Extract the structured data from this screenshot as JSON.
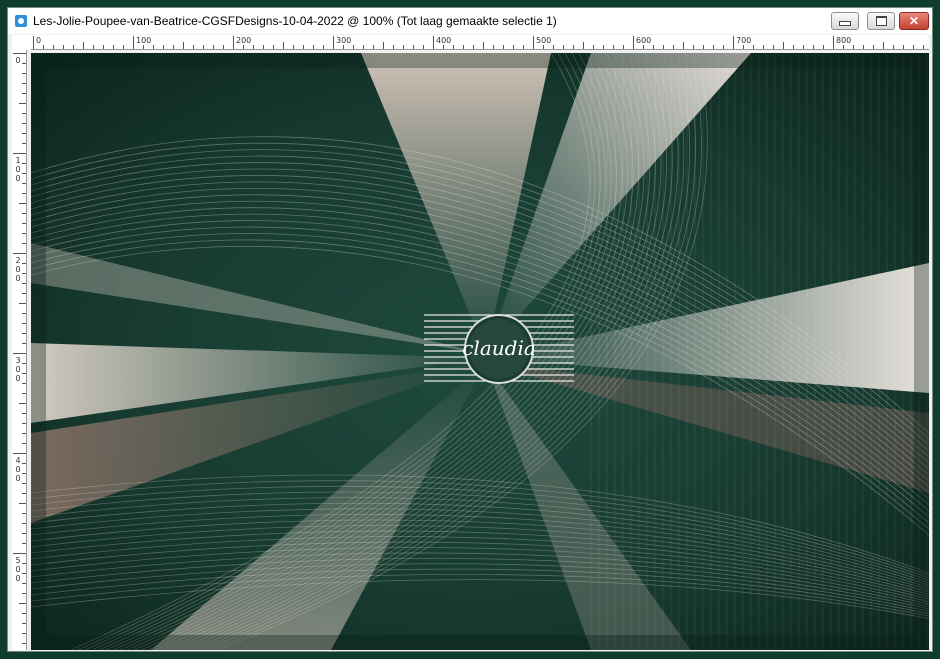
{
  "window": {
    "title": "Les-Jolie-Poupee-van-Beatrice-CGSFDesigns-10-04-2022 @ 100% (Tot laag gemaakte selectie 1)",
    "close_glyph": "✕"
  },
  "ruler_h_labels": [
    "0",
    "100",
    "200",
    "300",
    "400",
    "500",
    "600",
    "700",
    "800"
  ],
  "ruler_v_labels": [
    "0",
    "100",
    "200",
    "300",
    "400",
    "500"
  ],
  "watermark": {
    "logo_text": "claudia"
  },
  "colors": {
    "desktop": "#0f3d2c",
    "canvas_dark": "#0c2d22",
    "canvas_teal": "#1f4a3e",
    "canvas_cream": "#e8dcd2",
    "canvas_rose": "#b88b80"
  }
}
